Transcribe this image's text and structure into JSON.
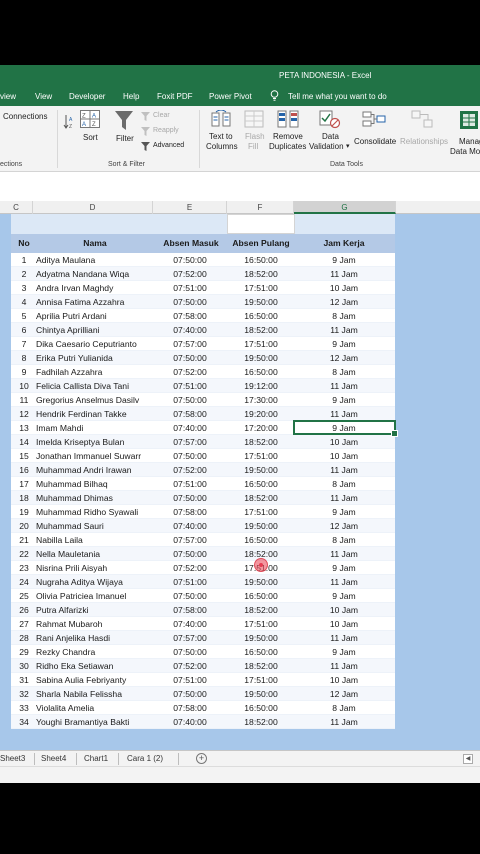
{
  "window": {
    "title": "PETA INDONESIA  -  Excel"
  },
  "ribbon_tabs": [
    "view",
    "View",
    "Developer",
    "Help",
    "Foxit PDF",
    "Power Pivot"
  ],
  "tell_me": "Tell me what you want to do",
  "ribbon": {
    "connections": "Connections",
    "connections_group": "ections",
    "sort": "Sort",
    "filter": "Filter",
    "clear": "Clear",
    "reapply": "Reapply",
    "advanced": "Advanced",
    "sort_filter_group": "Sort & Filter",
    "text_to_columns_1": "Text to",
    "text_to_columns_2": "Columns",
    "flash_fill_1": "Flash",
    "flash_fill_2": "Fill",
    "remove_dup_1": "Remove",
    "remove_dup_2": "Duplicates",
    "data_val_1": "Data",
    "data_val_2": "Validation",
    "consolidate": "Consolidate",
    "relationships": "Relationships",
    "manage_1": "Manag",
    "manage_2": "Data Mo",
    "data_tools_group": "Data Tools"
  },
  "columns": [
    "C",
    "D",
    "E",
    "F",
    "G"
  ],
  "table": {
    "headers": {
      "no": "No",
      "nama": "Nama",
      "masuk": "Absen Masuk",
      "pulang": "Absen Pulang",
      "jam": "Jam Kerja"
    },
    "rows": [
      [
        "1",
        "Aditya Maulana",
        "07:50:00",
        "16:50:00",
        "9 Jam"
      ],
      [
        "2",
        "Adyatma Nandana Wiqa",
        "07:52:00",
        "18:52:00",
        "11 Jam"
      ],
      [
        "3",
        "Andra Irvan Maghdy",
        "07:51:00",
        "17:51:00",
        "10 Jam"
      ],
      [
        "4",
        "Annisa Fatima Azzahra",
        "07:50:00",
        "19:50:00",
        "12 Jam"
      ],
      [
        "5",
        "Aprilia Putri Ardani",
        "07:58:00",
        "16:50:00",
        "8 Jam"
      ],
      [
        "6",
        "Chintya Aprilliani",
        "07:40:00",
        "18:52:00",
        "11 Jam"
      ],
      [
        "7",
        "Dika Caesario Ceputrianto",
        "07:57:00",
        "17:51:00",
        "9 Jam"
      ],
      [
        "8",
        "Erika Putri Yulianida",
        "07:50:00",
        "19:50:00",
        "12 Jam"
      ],
      [
        "9",
        "Fadhilah Azzahra",
        "07:52:00",
        "16:50:00",
        "8 Jam"
      ],
      [
        "10",
        "Felicia Callista Diva Tani",
        "07:51:00",
        "19:12:00",
        "11 Jam"
      ],
      [
        "11",
        "Gregorius Anselmus Dasilv",
        "07:50:00",
        "17:30:00",
        "9 Jam"
      ],
      [
        "12",
        "Hendrik Ferdinan Takke",
        "07:58:00",
        "19:20:00",
        "11 Jam"
      ],
      [
        "13",
        "Imam Mahdi",
        "07:40:00",
        "17:20:00",
        "9 Jam"
      ],
      [
        "14",
        "Imelda Kriseptya Bulan",
        "07:57:00",
        "18:52:00",
        "10 Jam"
      ],
      [
        "15",
        "Jonathan Immanuel Suwarr",
        "07:50:00",
        "17:51:00",
        "10 Jam"
      ],
      [
        "16",
        "Muhammad Andri Irawan",
        "07:52:00",
        "19:50:00",
        "11 Jam"
      ],
      [
        "17",
        "Muhammad Bilhaq",
        "07:51:00",
        "16:50:00",
        "8 Jam"
      ],
      [
        "18",
        "Muhammad Dhimas",
        "07:50:00",
        "18:52:00",
        "11 Jam"
      ],
      [
        "19",
        "Muhammad Ridho Syawali",
        "07:58:00",
        "17:51:00",
        "9 Jam"
      ],
      [
        "20",
        "Muhammad Sauri",
        "07:40:00",
        "19:50:00",
        "12 Jam"
      ],
      [
        "21",
        "Nabilla Laila",
        "07:57:00",
        "16:50:00",
        "8 Jam"
      ],
      [
        "22",
        "Nella Mauletania",
        "07:50:00",
        "18:52:00",
        "11 Jam"
      ],
      [
        "23",
        "Nisrina Prili Aisyah",
        "07:52:00",
        "17:51:00",
        "9 Jam"
      ],
      [
        "24",
        "Nugraha Aditya Wijaya",
        "07:51:00",
        "19:50:00",
        "11 Jam"
      ],
      [
        "25",
        "Olivia Patriciea Imanuel",
        "07:50:00",
        "16:50:00",
        "9 Jam"
      ],
      [
        "26",
        "Putra Alfarizki",
        "07:58:00",
        "18:52:00",
        "10 Jam"
      ],
      [
        "27",
        "Rahmat Mubaroh",
        "07:40:00",
        "17:51:00",
        "10 Jam"
      ],
      [
        "28",
        "Rani Anjelika Hasdi",
        "07:57:00",
        "19:50:00",
        "11 Jam"
      ],
      [
        "29",
        "Rezky Chandra",
        "07:50:00",
        "16:50:00",
        "9 Jam"
      ],
      [
        "30",
        "Ridho Eka Setiawan",
        "07:52:00",
        "18:52:00",
        "11 Jam"
      ],
      [
        "31",
        "Sabina Aulia Febriyanty",
        "07:51:00",
        "17:51:00",
        "10 Jam"
      ],
      [
        "32",
        "Sharla Nabila Felissha",
        "07:50:00",
        "19:50:00",
        "12 Jam"
      ],
      [
        "33",
        "Violalita Amelia",
        "07:58:00",
        "16:50:00",
        "8 Jam"
      ],
      [
        "34",
        "Youghi Bramantiya Bakti",
        "07:40:00",
        "18:52:00",
        "11 Jam"
      ]
    ]
  },
  "sheet_tabs": [
    "Sheet3",
    "Sheet4",
    "Chart1",
    "Cara 1 (2)"
  ],
  "colors": {
    "excel_green": "#217346",
    "header_fill": "#b4c9e6",
    "sheet_bg": "#a7c7ea"
  }
}
